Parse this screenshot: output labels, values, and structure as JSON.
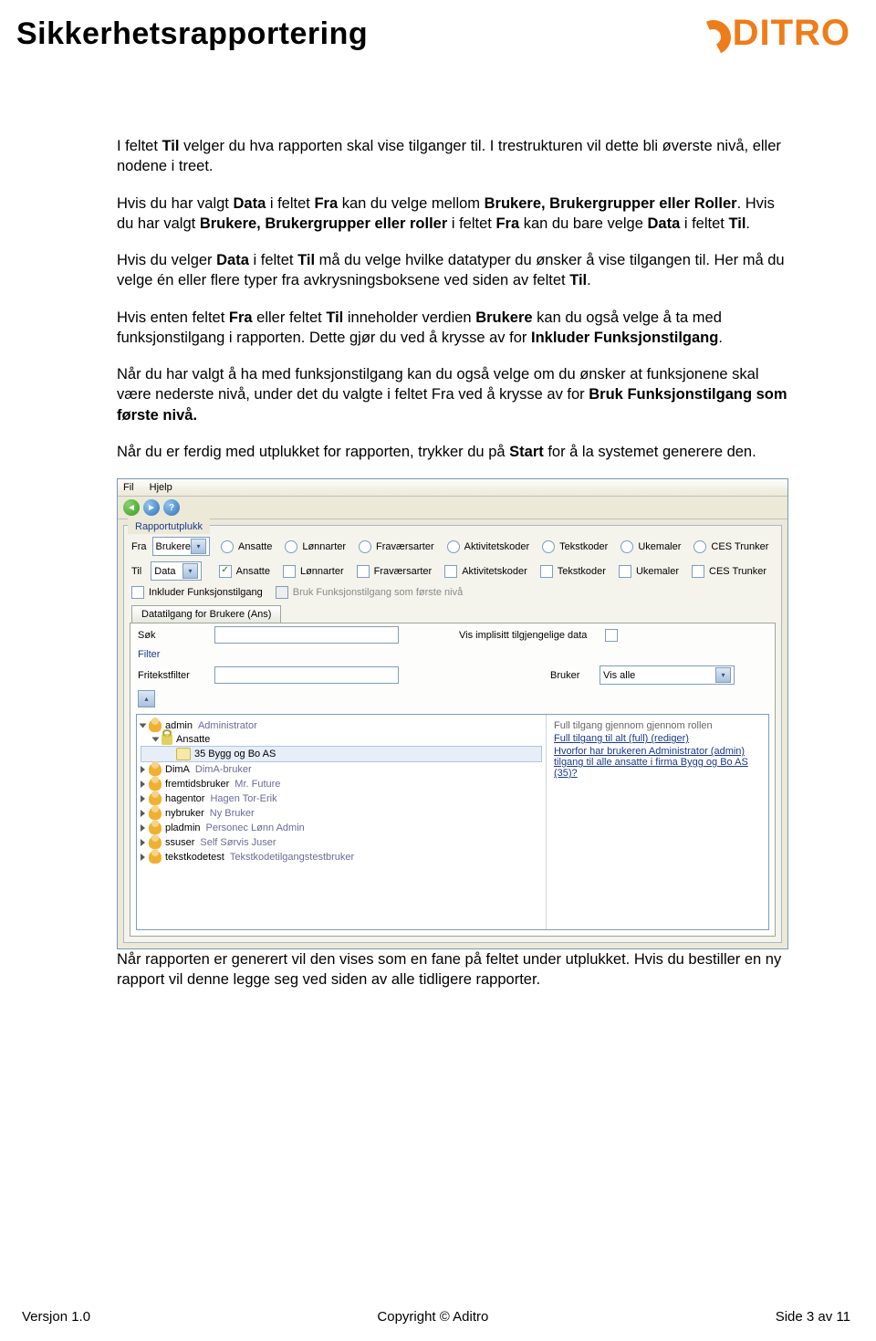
{
  "header": {
    "title": "Sikkerhetsrapportering",
    "logo_text": "DITRO"
  },
  "paragraphs": {
    "p1a": "I feltet ",
    "p1b": "Til",
    "p1c": " velger du hva rapporten skal vise tilganger til. I trestrukturen vil dette bli øverste nivå, eller nodene i treet.",
    "p2a": "Hvis du har valgt ",
    "p2b": "Data",
    "p2c": " i feltet ",
    "p2d": "Fra",
    "p2e": " kan du velge mellom ",
    "p2f": "Brukere, Brukergrupper eller Roller",
    "p2g": ". Hvis du har valgt ",
    "p2h": "Brukere, Brukergrupper eller roller",
    "p2i": " i feltet ",
    "p2j": "Fra",
    "p2k": " kan du bare velge ",
    "p2l": "Data",
    "p2m": " i feltet ",
    "p2n": "Til",
    "p2o": ".",
    "p3a": "Hvis du velger ",
    "p3b": "Data",
    "p3c": " i feltet ",
    "p3d": "Til",
    "p3e": " må du velge hvilke datatyper du ønsker å vise tilgangen til. Her må du velge én eller flere typer fra avkrysningsboksene ved siden av feltet ",
    "p3f": "Til",
    "p3g": ".",
    "p4a": "Hvis enten feltet ",
    "p4b": "Fra",
    "p4c": " eller feltet ",
    "p4d": "Til",
    "p4e": " inneholder verdien ",
    "p4f": "Brukere",
    "p4g": " kan du også velge å ta med funksjonstilgang i rapporten. Dette gjør du ved å krysse av for ",
    "p4h": "Inkluder Funksjonstilgang",
    "p4i": ".",
    "p5a": "Når du har valgt å ha med funksjonstilgang kan du også velge om du ønsker at funksjonene skal være nederste nivå, under det du valgte i feltet Fra ved å krysse av for ",
    "p5b": "Bruk Funksjonstilgang som første nivå.",
    "p6a": "Når du er ferdig med utplukket for rapporten, trykker du på ",
    "p6b": "Start",
    "p6c": " for å la systemet generere den.",
    "p7": "Når rapporten er generert vil den vises som en fane på feltet under utplukket. Hvis du bestiller en ny rapport vil denne legge seg ved siden av alle tidligere rapporter."
  },
  "app": {
    "menu": {
      "file": "Fil",
      "help": "Hjelp"
    },
    "group_title": "Rapportutplukk",
    "fra_label": "Fra",
    "til_label": "Til",
    "fra_value": "Brukere",
    "til_value": "Data",
    "options": [
      "Ansatte",
      "Lønnarter",
      "Fraværsarter",
      "Aktivitetskoder",
      "Tekstkoder",
      "Ukemaler",
      "CES Trunker"
    ],
    "chk_inkluder": "Inkluder Funksjonstilgang",
    "chk_bruk": "Bruk Funksjonstilgang som første nivå",
    "tab_title": "Datatilgang for Brukere (Ans)",
    "sok": "Søk",
    "vis_impl": "Vis implisitt tilgjengelige data",
    "filter": "Filter",
    "fritekst": "Fritekstfilter",
    "bruker_label": "Bruker",
    "bruker_value": "Vis alle",
    "tree": {
      "n0": {
        "user": "admin",
        "desc": "Administrator"
      },
      "n0a": "Ansatte",
      "n0b": "35 Bygg og Bo AS",
      "n1": {
        "user": "DimA",
        "desc": "DimA-bruker"
      },
      "n2": {
        "user": "fremtidsbruker",
        "desc": "Mr. Future"
      },
      "n3": {
        "user": "hagentor",
        "desc": "Hagen Tor-Erik"
      },
      "n4": {
        "user": "nybruker",
        "desc": "Ny Bruker"
      },
      "n5": {
        "user": "pladmin",
        "desc": "Personec Lønn Admin"
      },
      "n6": {
        "user": "ssuser",
        "desc": "Self Sørvis Juser"
      },
      "n7": {
        "user": "tekstkodetest",
        "desc": "Tekstkodetilgangstestbruker"
      }
    },
    "right": {
      "r1": "Full tilgang gjennom gjennom rollen",
      "r2": "Full tilgang til alt (full) (rediger)",
      "r3": "Hvorfor har brukeren Administrator (admin) tilgang til alle ansatte i firma Bygg og Bo AS (35)?"
    }
  },
  "footer": {
    "left": "Versjon 1.0",
    "center": "Copyright © Aditro",
    "right": "Side 3 av 11"
  }
}
